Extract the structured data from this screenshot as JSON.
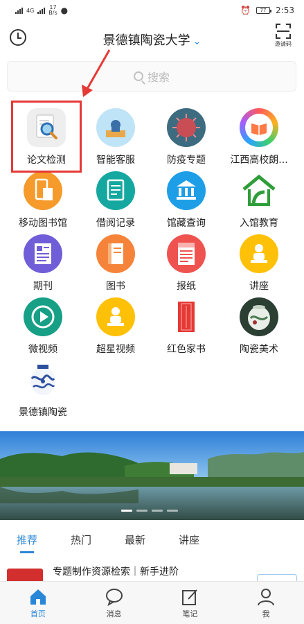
{
  "status": {
    "left_text": "4G",
    "speed": "17",
    "speed_unit": "B/s",
    "battery": "77",
    "time": "2:53"
  },
  "header": {
    "title": "景德镇陶瓷大学",
    "chevron": "⌄",
    "invite_label": "邀请码"
  },
  "search": {
    "placeholder": "搜索"
  },
  "grid": [
    {
      "label": "论文检测",
      "icon": "paper-check-icon"
    },
    {
      "label": "智能客服",
      "icon": "service-icon"
    },
    {
      "label": "防疫专题",
      "icon": "virus-icon"
    },
    {
      "label": "江西高校朗...",
      "icon": "book-ring-icon"
    },
    {
      "label": "移动图书馆",
      "icon": "mobile-library-icon"
    },
    {
      "label": "借阅记录",
      "icon": "borrow-record-icon"
    },
    {
      "label": "馆藏查询",
      "icon": "collection-search-icon"
    },
    {
      "label": "入馆教育",
      "icon": "house-hand-icon"
    },
    {
      "label": "期刊",
      "icon": "journal-icon"
    },
    {
      "label": "图书",
      "icon": "book-icon"
    },
    {
      "label": "报纸",
      "icon": "newspaper-icon"
    },
    {
      "label": "讲座",
      "icon": "lecture-icon"
    },
    {
      "label": "微视频",
      "icon": "play-icon"
    },
    {
      "label": "超星视频",
      "icon": "video-lecture-icon"
    },
    {
      "label": "红色家书",
      "icon": "red-letter-icon"
    },
    {
      "label": "陶瓷美术",
      "icon": "ceramic-art-icon"
    },
    {
      "label": "景德镇陶瓷",
      "icon": "porcelain-vase-icon"
    }
  ],
  "tabs": [
    "推荐",
    "热门",
    "最新",
    "讲座"
  ],
  "news": {
    "title": "专题制作资源检索｜新手进阶"
  },
  "bottom_nav": [
    {
      "label": "首页",
      "icon": "home-icon"
    },
    {
      "label": "消息",
      "icon": "message-icon"
    },
    {
      "label": "笔记",
      "icon": "note-icon"
    },
    {
      "label": "我",
      "icon": "profile-icon"
    }
  ],
  "colors": {
    "accent": "#2a87d8",
    "highlight": "#e53935"
  }
}
